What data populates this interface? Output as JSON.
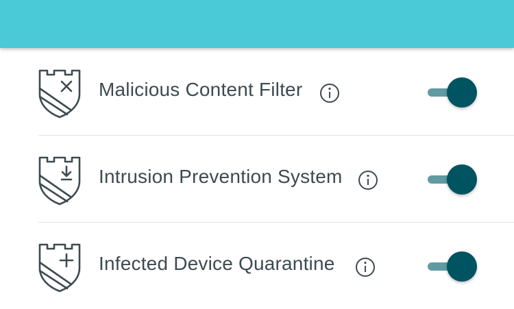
{
  "colors": {
    "header_bg": "#4ac9d6",
    "text": "#3d4a50",
    "icon_stroke": "#3d4a50",
    "toggle_track": "#5f9ba1",
    "toggle_knob": "#005461"
  },
  "features": [
    {
      "label": "Malicious Content Filter",
      "icon": "shield-x-icon",
      "enabled": true
    },
    {
      "label": "Intrusion Prevention System",
      "icon": "shield-download-icon",
      "enabled": true
    },
    {
      "label": "Infected Device Quarantine",
      "icon": "shield-plus-icon",
      "enabled": true
    }
  ]
}
